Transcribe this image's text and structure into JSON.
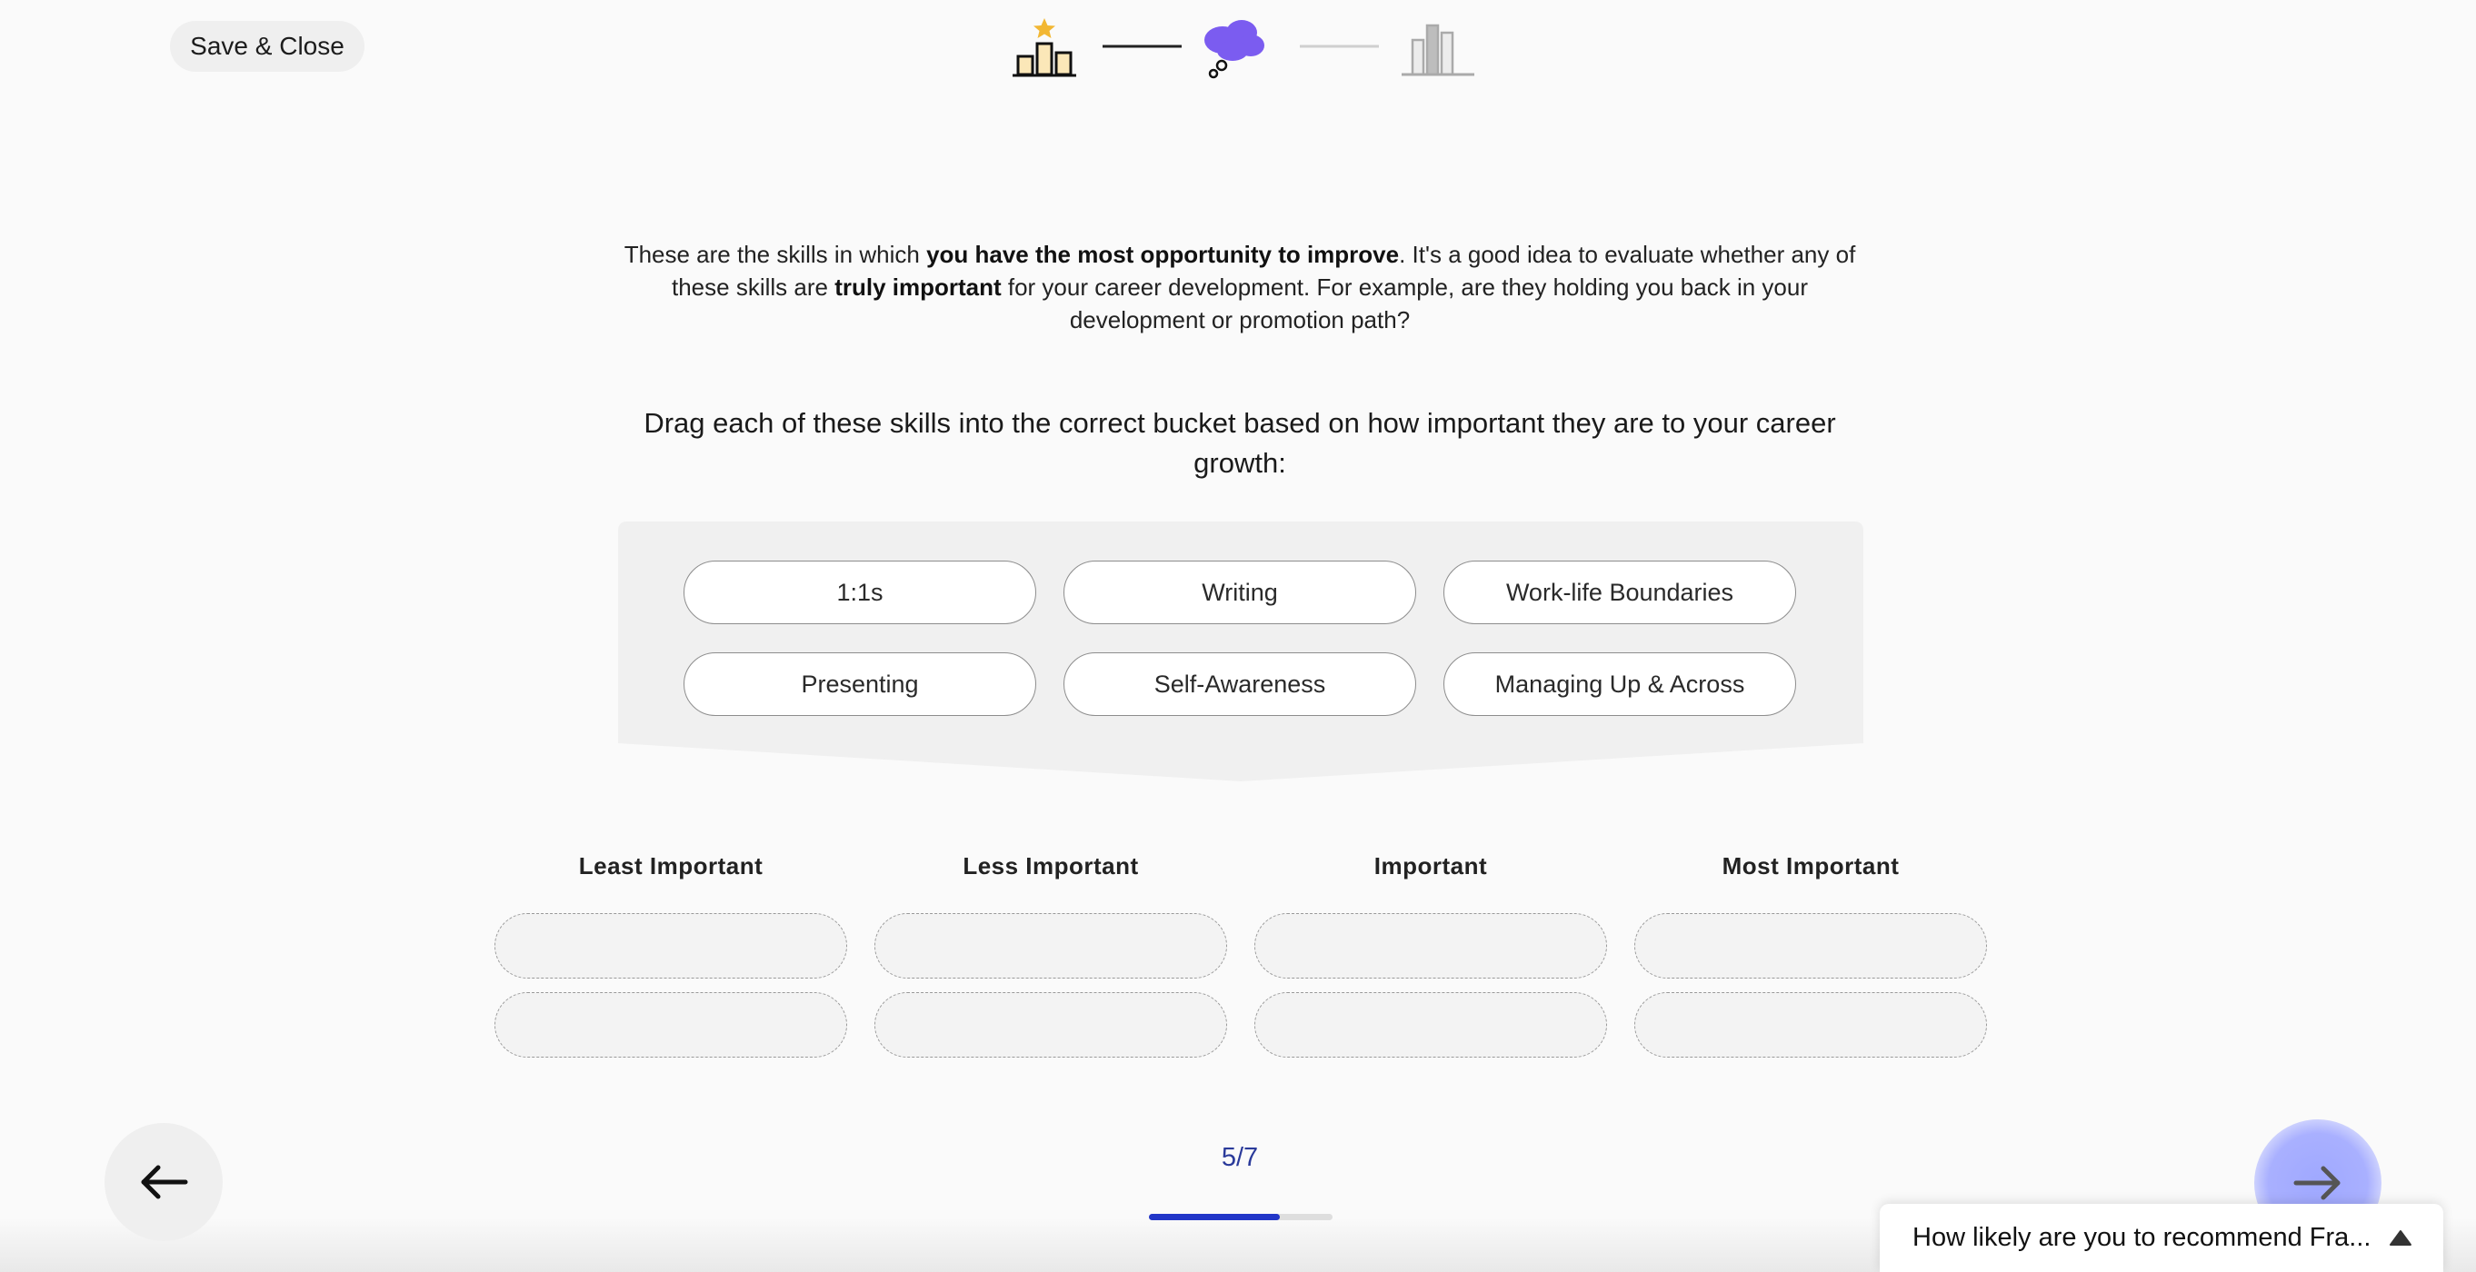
{
  "header": {
    "save_close_label": "Save & Close",
    "stepper": [
      {
        "name": "podium-step",
        "state": "completed"
      },
      {
        "name": "thought-cloud-step",
        "state": "current"
      },
      {
        "name": "bar-chart-step",
        "state": "upcoming"
      }
    ]
  },
  "intro": {
    "p1": "These are the skills in which ",
    "b1": "you have the most opportunity to improve",
    "p2": ". It's a good idea to evaluate whether any of these skills are ",
    "b2": "truly important",
    "p3": " for your career development. For example, are they holding you back in your development or promotion path?"
  },
  "instruction": "Drag each of these skills into the correct bucket based on how important they are to your career growth:",
  "skills": [
    "1:1s",
    "Writing",
    "Work-life Boundaries",
    "Presenting",
    "Self-Awareness",
    "Managing Up & Across"
  ],
  "buckets": [
    {
      "title": "Least Important"
    },
    {
      "title": "Less Important"
    },
    {
      "title": "Important"
    },
    {
      "title": "Most Important"
    }
  ],
  "pagination": {
    "counter": "5/7",
    "current": 5,
    "total": 7
  },
  "feedback": {
    "text": "How likely are you to recommend Fra..."
  },
  "colors": {
    "accent": "#2236c8",
    "next_button_glow": "#a9b0ff",
    "cloud_purple": "#7b5cf0",
    "star_gold": "#f2b733"
  },
  "icons": {
    "back": "arrow-left-icon",
    "next": "arrow-right-icon",
    "caret": "caret-up-icon"
  }
}
